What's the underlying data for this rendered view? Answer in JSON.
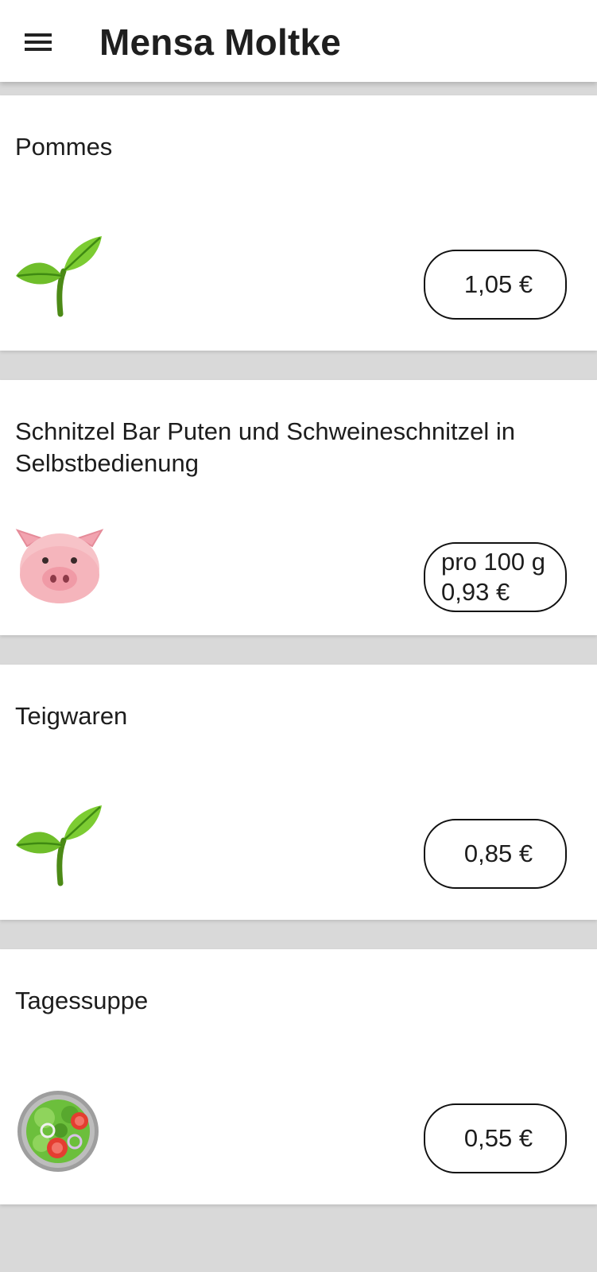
{
  "appbar": {
    "title": "Mensa Moltke",
    "menu_icon": "hamburger-menu-icon"
  },
  "meals": [
    {
      "name": "Pommes",
      "icon": "seedling-icon",
      "price": "1,05 €"
    },
    {
      "name": "Schnitzel Bar Puten und Schweineschnitzel in Selbstbedienung",
      "icon": "pig-face-icon",
      "price_line1": "pro 100 g",
      "price_line2": "0,93 €"
    },
    {
      "name": "Teigwaren",
      "icon": "seedling-icon",
      "price": "0,85 €"
    },
    {
      "name": "Tagessuppe",
      "icon": "salad-icon",
      "price": "0,55 €"
    }
  ],
  "colors": {
    "background": "#d9d9d9",
    "card": "#ffffff",
    "text": "#1d1d1d"
  }
}
